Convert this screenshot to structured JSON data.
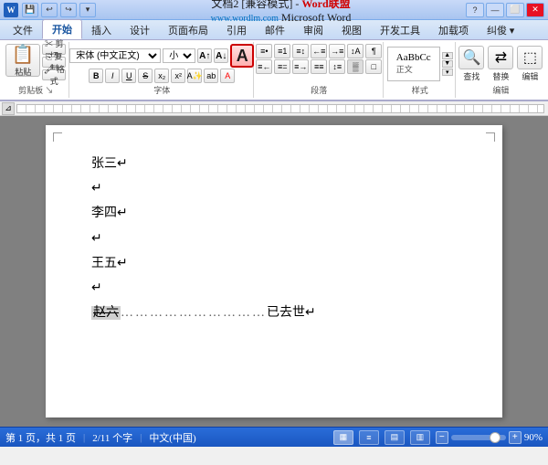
{
  "titleBar": {
    "appIcon": "W",
    "quickAccess": [
      "💾",
      "↩",
      "↪",
      "▾"
    ],
    "title1": "文档2 [兼容模式] - ",
    "brand": "Word联盟",
    "url": "www.wordlm.com",
    "title2": "icrosoft Word",
    "windowControls": [
      "?",
      "—",
      "⬜",
      "✕"
    ]
  },
  "ribbonTabs": {
    "tabs": [
      "文件",
      "开始",
      "插入",
      "设计",
      "页面布局",
      "引用",
      "邮件",
      "审阅",
      "视图",
      "开发工具",
      "加载项",
      "纠俊▾"
    ],
    "activeTab": "开始"
  },
  "fontGroup": {
    "fontName": "宋体 (中文正文)",
    "fontSize": "小二",
    "bigALabel": "A",
    "label": "字体"
  },
  "paragraphGroup": {
    "label": "段落"
  },
  "stylesGroup": {
    "label": "样式",
    "editLabel": "编辑"
  },
  "document": {
    "lines": [
      {
        "id": "line1",
        "text": "张三↵",
        "style": "normal"
      },
      {
        "id": "line2",
        "text": "↵",
        "style": "normal"
      },
      {
        "id": "line3",
        "text": "李四↵",
        "style": "normal"
      },
      {
        "id": "line4",
        "text": "↵",
        "style": "normal"
      },
      {
        "id": "line5",
        "text": "王五↵",
        "style": "normal"
      },
      {
        "id": "line6",
        "text": "↵",
        "style": "normal"
      },
      {
        "id": "line6b",
        "strikePrefix": "赵六",
        "dots": "…………………………",
        "suffix": "已去世↵",
        "style": "strikethrough"
      }
    ]
  },
  "statusBar": {
    "page": "第 1 页，共 1 页",
    "wordCount": "2/11 个字",
    "lang": "中文(中国)",
    "zoom": "90%",
    "viewButtons": [
      "▦",
      "≡",
      "▤",
      "▥"
    ]
  }
}
